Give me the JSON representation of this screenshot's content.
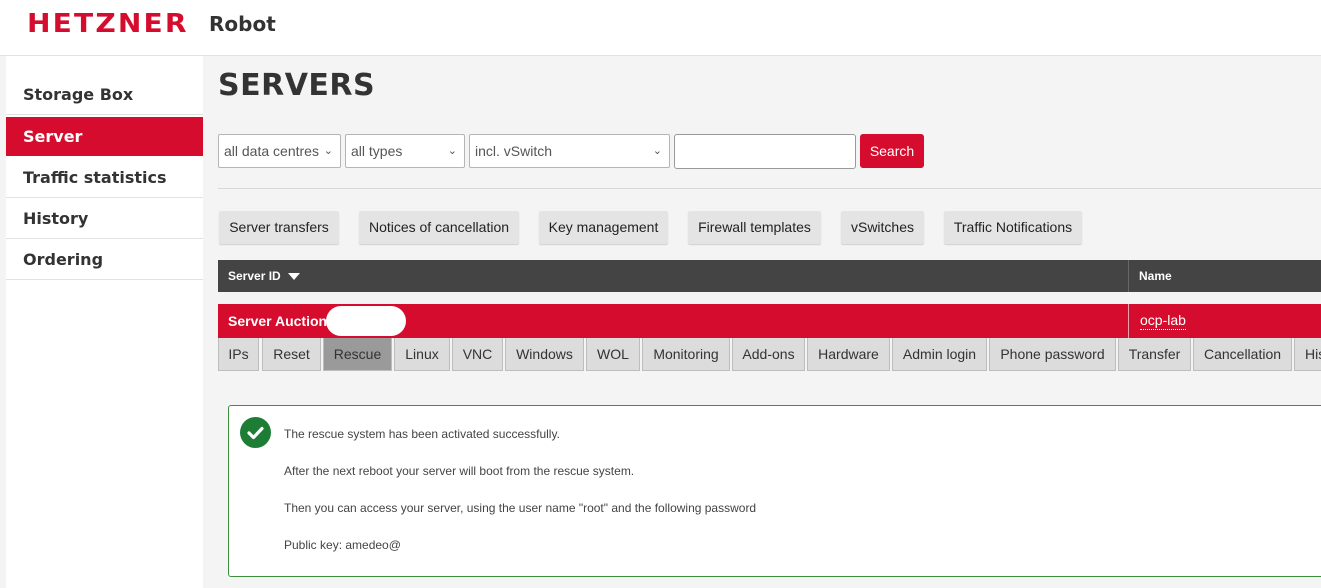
{
  "brand": {
    "logo_text": "HETZNER",
    "app_name": "Robot",
    "accent": "#d50c2d"
  },
  "sidebar": {
    "items": [
      {
        "label": "Storage Box"
      },
      {
        "label": "Server"
      },
      {
        "label": "Traffic statistics"
      },
      {
        "label": "History"
      },
      {
        "label": "Ordering"
      }
    ],
    "active_index": 1
  },
  "page": {
    "title": "SERVERS"
  },
  "filters": {
    "data_centre": "all data centres",
    "type": "all types",
    "vswitch": "incl. vSwitch",
    "search_value": "",
    "search_label": "Search"
  },
  "tools": [
    {
      "label": "Server transfers"
    },
    {
      "label": "Notices of cancellation"
    },
    {
      "label": "Key management"
    },
    {
      "label": "Firewall templates"
    },
    {
      "label": "vSwitches"
    },
    {
      "label": "Traffic Notifications"
    }
  ],
  "table": {
    "col_server_id": "Server ID",
    "col_name": "Name",
    "row": {
      "server_id": "Server Auction",
      "name": "ocp-lab"
    }
  },
  "tabs": [
    {
      "label": "IPs"
    },
    {
      "label": "Reset"
    },
    {
      "label": "Rescue"
    },
    {
      "label": "Linux"
    },
    {
      "label": "VNC"
    },
    {
      "label": "Windows"
    },
    {
      "label": "WOL"
    },
    {
      "label": "Monitoring"
    },
    {
      "label": "Add-ons"
    },
    {
      "label": "Hardware"
    },
    {
      "label": "Admin login"
    },
    {
      "label": "Phone password"
    },
    {
      "label": "Transfer"
    },
    {
      "label": "Cancellation"
    },
    {
      "label": "His"
    }
  ],
  "active_tab": "Rescue",
  "alert": {
    "line1": "The rescue system has been activated successfully.",
    "line2": "After the next reboot your server will boot from the rescue system.",
    "line3": "Then you can access your server, using the user name \"root\" and the following password",
    "line4": "Public key: amedeo@",
    "status_color": "#1e7d34"
  }
}
